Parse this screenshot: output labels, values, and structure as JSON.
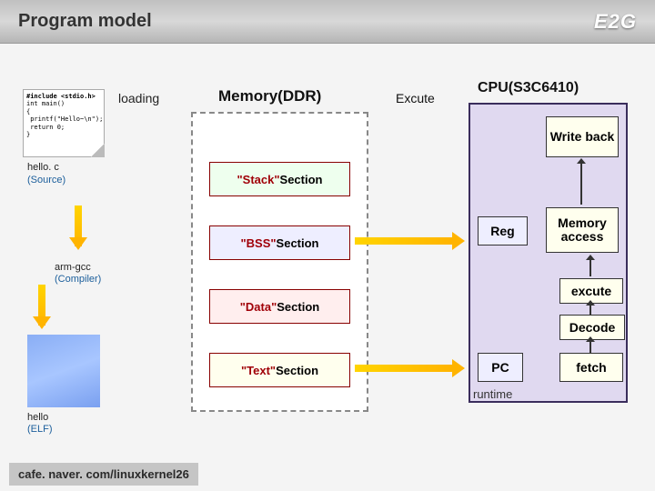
{
  "header": {
    "title": "Program model",
    "logo": "E2G"
  },
  "code": {
    "include": "#include <stdio.h>",
    "body": "int main()\n{\n printf(\"Hello~\\n\");\n return 0;\n}"
  },
  "labels": {
    "loading": "loading",
    "memory_title": "Memory(DDR)",
    "excute": "Excute",
    "cpu_title": "CPU(S3C6410)",
    "runtime": "runtime",
    "hello_c": "hello. c",
    "source": "(Source)",
    "arm_gcc": "arm-gcc",
    "compiler": "(Compiler)",
    "hello": "hello",
    "elf": "(ELF)"
  },
  "sections": {
    "stack": {
      "q": "\"Stack\"",
      "s": " Section"
    },
    "bss": {
      "q": "\"BSS\"",
      "s": " Section"
    },
    "data": {
      "q": "\"Data\"",
      "s": " Section"
    },
    "text": {
      "q": "\"Text\"",
      "s": " Section"
    }
  },
  "cpu": {
    "wb": "Write back",
    "mem": "Memory access",
    "reg": "Reg",
    "exc": "excute",
    "dec": "Decode",
    "pc": "PC",
    "fetch": "fetch"
  },
  "footer": "cafe. naver. com/linuxkernel26"
}
